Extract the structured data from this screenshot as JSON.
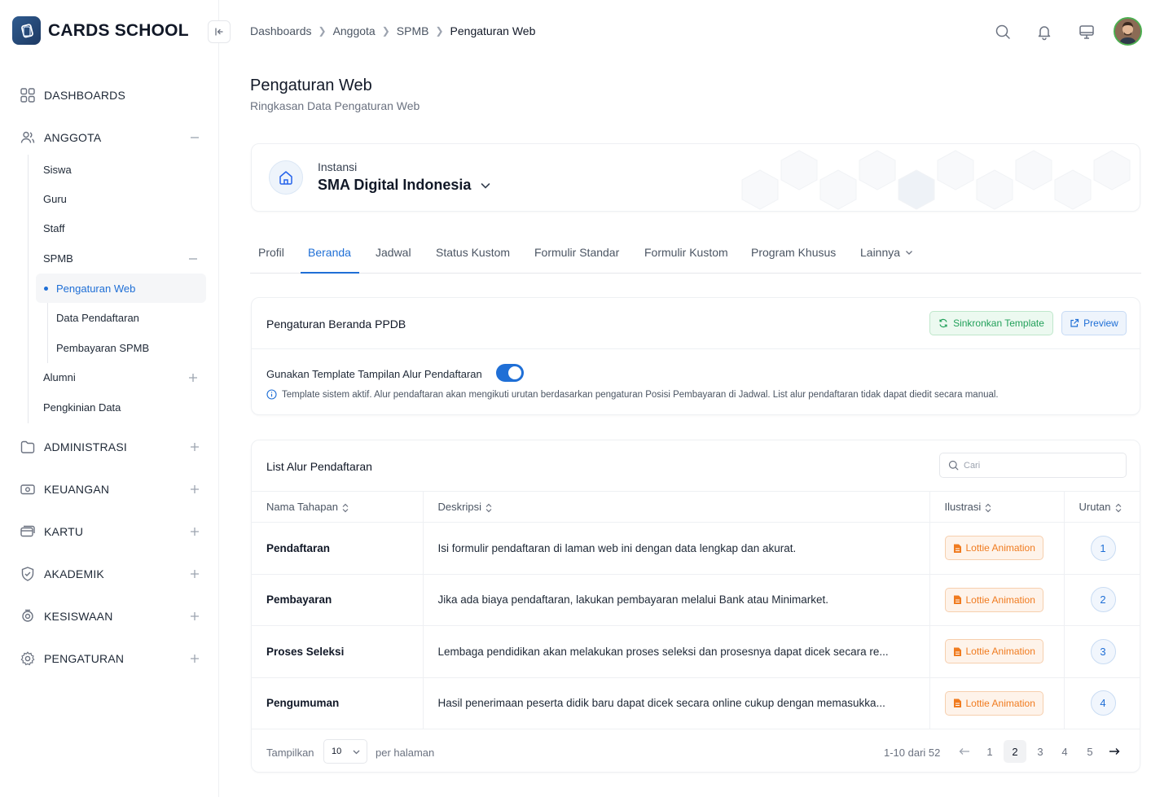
{
  "brand": {
    "name": "CARDS SCHOOL"
  },
  "breadcrumb": [
    "Dashboards",
    "Anggota",
    "SPMB",
    "Pengaturan Web"
  ],
  "sidebar": {
    "dashboards": "DASHBOARDS",
    "anggota": "ANGGOTA",
    "anggota_items": [
      "Siswa",
      "Guru",
      "Staff",
      "SPMB"
    ],
    "spmb_items": [
      "Pengaturan Web",
      "Data Pendaftaran",
      "Pembayaran SPMB"
    ],
    "anggota_items_after": [
      "Alumni",
      "Pengkinian Data"
    ],
    "administrasi": "ADMINISTRASI",
    "keuangan": "KEUANGAN",
    "kartu": "KARTU",
    "akademik": "AKADEMIK",
    "kesiswaan": "KESISWAAN",
    "pengaturan": "PENGATURAN"
  },
  "page": {
    "title": "Pengaturan Web",
    "subtitle": "Ringkasan Data Pengaturan Web"
  },
  "instance": {
    "label": "Instansi",
    "name": "SMA Digital Indonesia"
  },
  "tabs": [
    "Profil",
    "Beranda",
    "Jadwal",
    "Status Kustom",
    "Formulir Standar",
    "Formulir Kustom",
    "Program Khusus",
    "Lainnya"
  ],
  "active_tab": "Beranda",
  "settings_card": {
    "title": "Pengaturan Beranda PPDB",
    "sync_label": "Sinkronkan Template",
    "preview_label": "Preview",
    "toggle_label": "Gunakan Template Tampilan Alur Pendaftaran",
    "toggle_on": true,
    "info": "Template sistem aktif. Alur pendaftaran akan mengikuti urutan berdasarkan pengaturan Posisi Pembayaran di Jadwal. List alur pendaftaran tidak dapat diedit secara manual."
  },
  "list_card": {
    "title": "List Alur Pendaftaran",
    "search_placeholder": "Cari",
    "columns": [
      "Nama Tahapan",
      "Deskripsi",
      "Ilustrasi",
      "Urutan"
    ],
    "rows": [
      {
        "name": "Pendaftaran",
        "desc": "Isi formulir pendaftaran di laman web ini dengan data lengkap dan akurat.",
        "illus": "Lottie Animation",
        "order": "1"
      },
      {
        "name": "Pembayaran",
        "desc": "Jika ada biaya pendaftaran, lakukan pembayaran melalui Bank atau Minimarket.",
        "illus": "Lottie Animation",
        "order": "2"
      },
      {
        "name": "Proses Seleksi",
        "desc": "Lembaga pendidikan akan melakukan proses seleksi dan prosesnya dapat dicek secara re...",
        "illus": "Lottie Animation",
        "order": "3"
      },
      {
        "name": "Pengumuman",
        "desc": "Hasil penerimaan peserta didik baru dapat dicek secara online cukup dengan memasukka...",
        "illus": "Lottie Animation",
        "order": "4"
      }
    ]
  },
  "pagination": {
    "show_label": "Tampilkan",
    "page_size": "10",
    "per_page_label": "per halaman",
    "range": "1-10 dari 52",
    "pages": [
      "1",
      "2",
      "3",
      "4",
      "5"
    ],
    "current_page": "2"
  },
  "colors": {
    "accent": "#1f6fd6",
    "success": "#22a05a",
    "warning": "#f07b1f"
  }
}
